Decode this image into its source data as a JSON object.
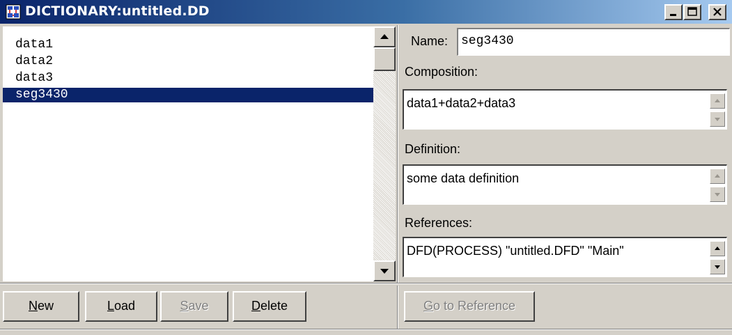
{
  "window": {
    "title": "DICTIONARY:untitled.DD",
    "controls": [
      "minimize",
      "maximize",
      "close"
    ]
  },
  "list": {
    "items": [
      "data1",
      "data2",
      "data3",
      "seg3430"
    ],
    "selected": "seg3430"
  },
  "details": {
    "name_label": "Name:",
    "name_value": "seg3430",
    "composition_label": "Composition:",
    "composition_value": "data1+data2+data3",
    "definition_label": "Definition:",
    "definition_value": "some data definition",
    "references_label": "References:",
    "references_value": "DFD(PROCESS) \"untitled.DFD\" \"Main\""
  },
  "buttons": {
    "new": "New",
    "load": "Load",
    "save": "Save",
    "delete": "Delete",
    "go_to_reference": "Go to Reference"
  },
  "icons": [
    "app-icon",
    "minimize-icon",
    "maximize-icon",
    "close-icon",
    "scroll-up-arrow-icon",
    "scroll-down-arrow-icon"
  ],
  "colors": {
    "title_bar_start": "#0a246a",
    "title_bar_end": "#a6caf0",
    "selection": "#0a246a",
    "face": "#d4d0c8"
  }
}
